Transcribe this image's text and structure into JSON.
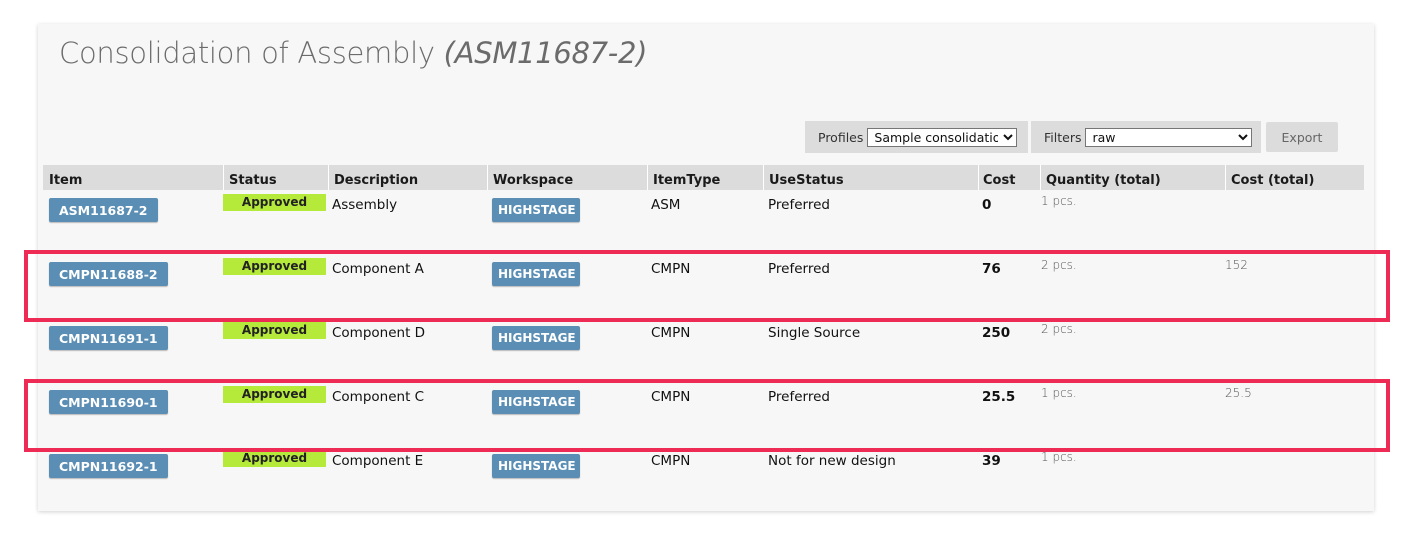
{
  "page": {
    "title": "Consolidation of Assembly",
    "title_sub": "(ASM11687-2)"
  },
  "controls": {
    "profiles_label": "Profiles",
    "profiles_value": "Sample consolidation",
    "filters_label": "Filters",
    "filters_value": "raw",
    "export_label": "Export"
  },
  "table": {
    "columns": [
      "Item",
      "Status",
      "Description",
      "Workspace",
      "ItemType",
      "UseStatus",
      "Cost",
      "Quantity (total)",
      "Cost (total)"
    ],
    "rows": [
      {
        "item": "ASM11687-2",
        "status": "Approved",
        "description": "Assembly",
        "workspace": "HIGHSTAGE",
        "item_type": "ASM",
        "use_status": "Preferred",
        "cost": "0",
        "quantity": "1 pcs.",
        "cost_total": ""
      },
      {
        "item": "CMPN11688-2",
        "status": "Approved",
        "description": "Component A",
        "workspace": "HIGHSTAGE",
        "item_type": "CMPN",
        "use_status": "Preferred",
        "cost": "76",
        "quantity": "2 pcs.",
        "cost_total": "152"
      },
      {
        "item": "CMPN11691-1",
        "status": "Approved",
        "description": "Component D",
        "workspace": "HIGHSTAGE",
        "item_type": "CMPN",
        "use_status": "Single Source",
        "cost": "250",
        "quantity": "2 pcs.",
        "cost_total": ""
      },
      {
        "item": "CMPN11690-1",
        "status": "Approved",
        "description": "Component C",
        "workspace": "HIGHSTAGE",
        "item_type": "CMPN",
        "use_status": "Preferred",
        "cost": "25.5",
        "quantity": "1 pcs.",
        "cost_total": "25.5"
      },
      {
        "item": "CMPN11692-1",
        "status": "Approved",
        "description": "Component E",
        "workspace": "HIGHSTAGE",
        "item_type": "CMPN",
        "use_status": "Not for new design",
        "cost": "39",
        "quantity": "1 pcs.",
        "cost_total": ""
      }
    ]
  },
  "colors": {
    "item_button": "#5b8eb5",
    "status_approved": "#b6ea3a",
    "highlight": "#ee2b55"
  }
}
